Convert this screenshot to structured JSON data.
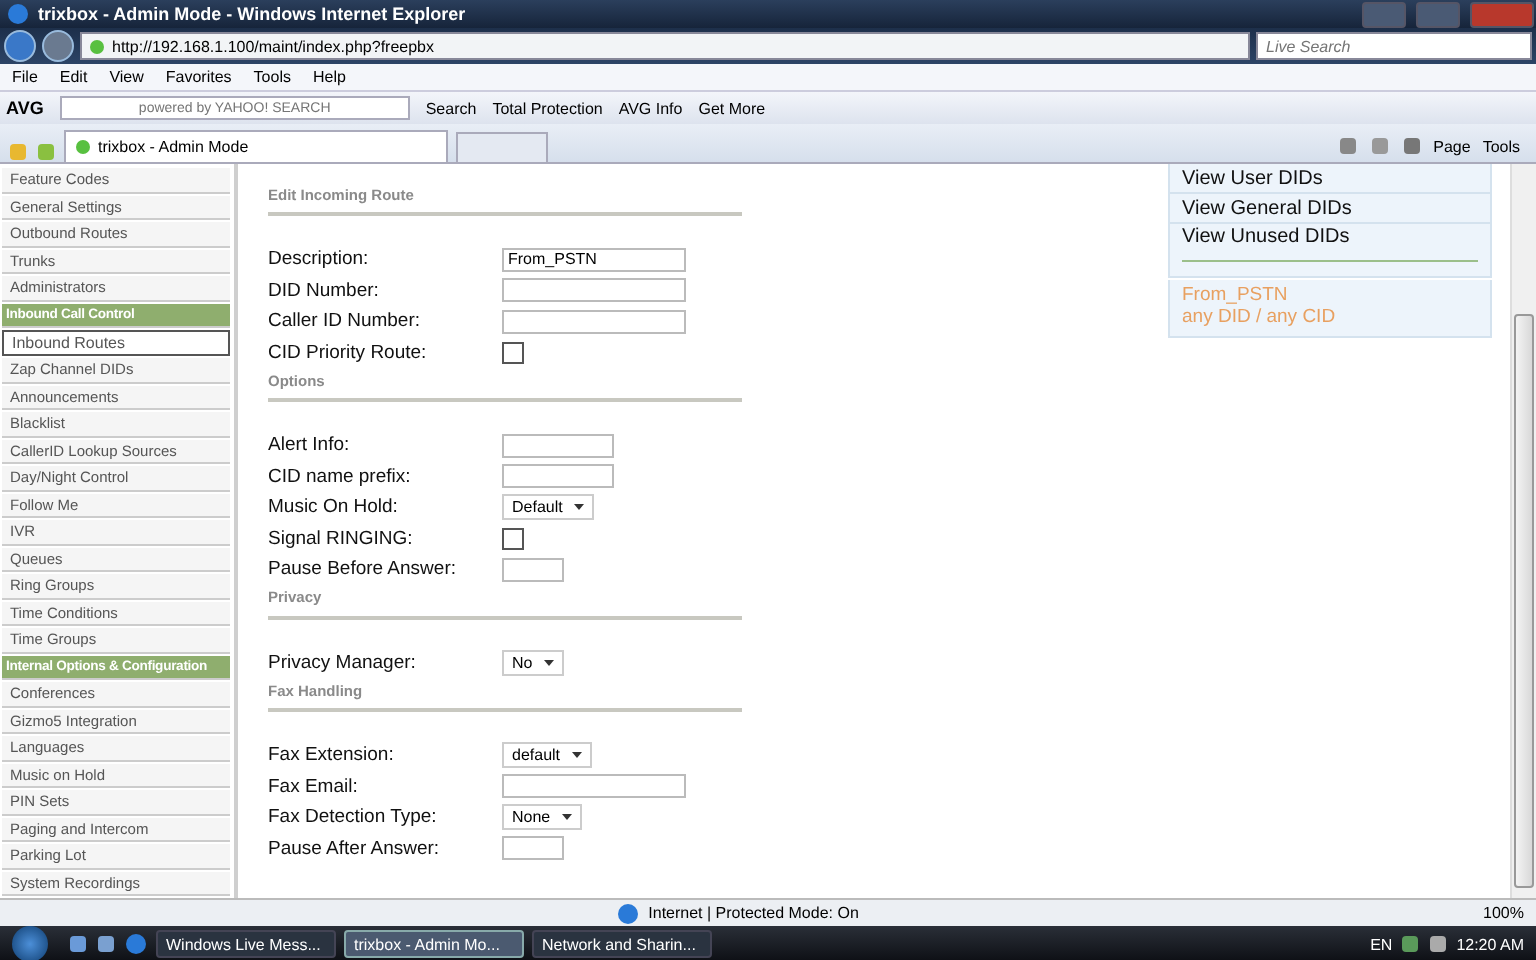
{
  "window": {
    "title": "trixbox - Admin Mode - Windows Internet Explorer"
  },
  "address_bar": {
    "url": "http://192.168.1.100/maint/index.php?freepbx",
    "search_placeholder": "Live Search"
  },
  "menu": [
    "File",
    "Edit",
    "View",
    "Favorites",
    "Tools",
    "Help"
  ],
  "toolbar": {
    "brand": "AVG",
    "search_placeholder": "powered by YAHOO! SEARCH",
    "buttons": [
      "Search",
      "Total Protection",
      "AVG Info",
      "Get More"
    ]
  },
  "tab": {
    "title": "trixbox - Admin Mode"
  },
  "command_bar": [
    "Page",
    "Tools"
  ],
  "sidebar": {
    "items": [
      {
        "label": "Feature Codes",
        "kind": "link",
        "selected": false
      },
      {
        "label": "General Settings",
        "kind": "link",
        "selected": false
      },
      {
        "label": "Outbound Routes",
        "kind": "link",
        "selected": false
      },
      {
        "label": "Trunks",
        "kind": "link",
        "selected": false
      },
      {
        "label": "Administrators",
        "kind": "link",
        "selected": false
      },
      {
        "label": "Inbound Call Control",
        "kind": "header",
        "selected": false
      },
      {
        "label": "Inbound Routes",
        "kind": "link",
        "selected": true
      },
      {
        "label": "Zap Channel DIDs",
        "kind": "link",
        "selected": false
      },
      {
        "label": "Announcements",
        "kind": "link",
        "selected": false
      },
      {
        "label": "Blacklist",
        "kind": "link",
        "selected": false
      },
      {
        "label": "CallerID Lookup Sources",
        "kind": "link",
        "selected": false
      },
      {
        "label": "Day/Night Control",
        "kind": "link",
        "selected": false
      },
      {
        "label": "Follow Me",
        "kind": "link",
        "selected": false
      },
      {
        "label": "IVR",
        "kind": "link",
        "selected": false
      },
      {
        "label": "Queues",
        "kind": "link",
        "selected": false
      },
      {
        "label": "Ring Groups",
        "kind": "link",
        "selected": false
      },
      {
        "label": "Time Conditions",
        "kind": "link",
        "selected": false
      },
      {
        "label": "Time Groups",
        "kind": "link",
        "selected": false
      },
      {
        "label": "Internal Options & Configuration",
        "kind": "header",
        "selected": false
      },
      {
        "label": "Conferences",
        "kind": "link",
        "selected": false
      },
      {
        "label": "Gizmo5 Integration",
        "kind": "link",
        "selected": false
      },
      {
        "label": "Languages",
        "kind": "link",
        "selected": false
      },
      {
        "label": "Music on Hold",
        "kind": "link",
        "selected": false
      },
      {
        "label": "PIN Sets",
        "kind": "link",
        "selected": false
      },
      {
        "label": "Paging and Intercom",
        "kind": "link",
        "selected": false
      },
      {
        "label": "Parking Lot",
        "kind": "link",
        "selected": false
      },
      {
        "label": "System Recordings",
        "kind": "link",
        "selected": false
      }
    ]
  },
  "form": {
    "sections": [
      {
        "title": "Edit Incoming Route",
        "fields": [
          {
            "label": "Description:",
            "kind": "text",
            "value": "From_PSTN"
          },
          {
            "label": "DID Number:",
            "kind": "text"
          },
          {
            "label": "Caller ID Number:",
            "kind": "text"
          },
          {
            "label": "CID Priority Route:",
            "kind": "checkbox",
            "checked": false
          }
        ]
      },
      {
        "title": "Options",
        "fields": [
          {
            "label": "Alert Info:",
            "kind": "short"
          },
          {
            "label": "CID name prefix:",
            "kind": "short"
          },
          {
            "label": "Music On Hold:",
            "kind": "select",
            "value": "Default"
          },
          {
            "label": "Signal RINGING:",
            "kind": "checkbox",
            "checked": false
          },
          {
            "label": "Pause Before Answer:",
            "kind": "number"
          }
        ]
      },
      {
        "title": "Privacy",
        "fields": [
          {
            "label": "Privacy Manager:",
            "kind": "select",
            "value": "No"
          }
        ]
      },
      {
        "title": "Fax Handling",
        "fields": [
          {
            "label": "Fax Extension:",
            "kind": "select",
            "value": "default"
          },
          {
            "label": "Fax Email:",
            "kind": "text"
          },
          {
            "label": "Fax Detection Type:",
            "kind": "select",
            "value": "None"
          },
          {
            "label": "Pause After Answer:",
            "kind": "number"
          }
        ]
      }
    ]
  },
  "right_panel": {
    "links": [
      "View User DIDs",
      "View General DIDs",
      "View Unused DIDs"
    ],
    "routes": [
      {
        "name": "From_PSTN",
        "detail": "any DID / any CID"
      }
    ]
  },
  "status_bar": {
    "zone": "Internet | Protected Mode: On",
    "zoom": "100%"
  },
  "taskbar": {
    "buttons": [
      {
        "label": "Windows Live Mess...",
        "selected": false
      },
      {
        "label": "trixbox - Admin Mo...",
        "selected": true
      },
      {
        "label": "Network and Sharin...",
        "selected": false
      }
    ],
    "language": "EN",
    "clock": "12:20 AM"
  }
}
